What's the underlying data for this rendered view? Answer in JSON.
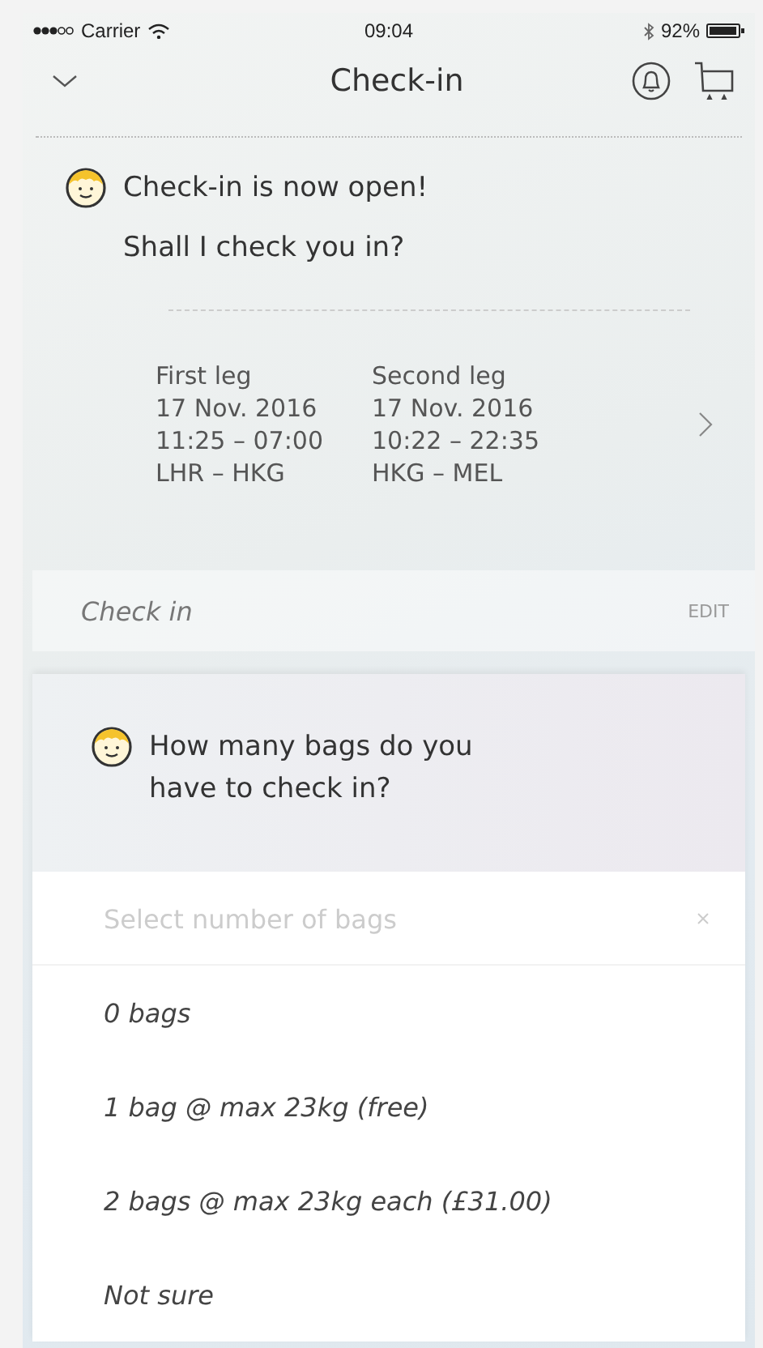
{
  "status_bar": {
    "carrier": "Carrier",
    "time": "09:04",
    "battery": "92%"
  },
  "nav": {
    "title": "Check-in"
  },
  "chat": {
    "messages": [
      "Check-in is now open!",
      "Shall I check you in?"
    ]
  },
  "legs": [
    {
      "label": "First leg",
      "date": "17 Nov. 2016",
      "times": "11:25 – 07:00",
      "route": "LHR – HKG"
    },
    {
      "label": "Second leg",
      "date": "17 Nov. 2016",
      "times": "10:22 – 22:35",
      "route": "HKG – MEL"
    }
  ],
  "check_in_row": {
    "label": "Check in",
    "action": "EDIT"
  },
  "bags": {
    "question": "How many bags do you have to check in?",
    "placeholder": "Select number of bags",
    "options": [
      {
        "label": "0 bags",
        "selected": false
      },
      {
        "label": "1 bag @ max 23kg (free)",
        "selected": false
      },
      {
        "label": "2 bags @ max 23kg each (£31.00)",
        "selected": false
      },
      {
        "label": "Not sure",
        "selected": false
      }
    ]
  }
}
